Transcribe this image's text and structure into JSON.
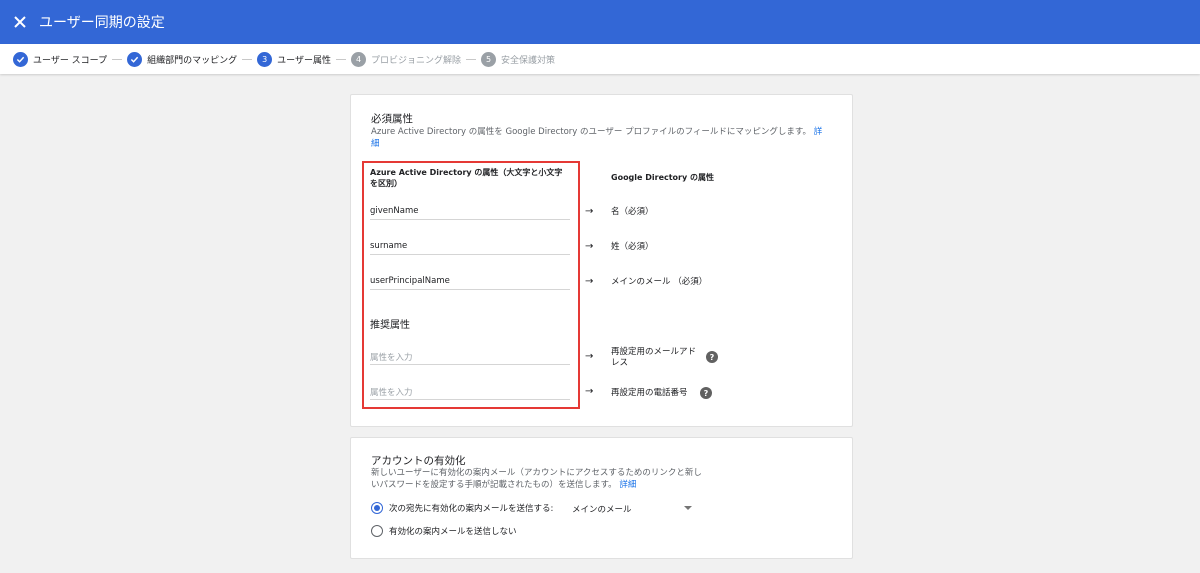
{
  "header": {
    "title": "ユーザー同期の設定"
  },
  "steps": [
    {
      "label": "ユーザー スコープ",
      "marker": "",
      "state": "done"
    },
    {
      "label": "組織部門のマッピング",
      "marker": "",
      "state": "done"
    },
    {
      "label": "ユーザー属性",
      "marker": "3",
      "state": "active"
    },
    {
      "label": "プロビジョニング解除",
      "marker": "4",
      "state": "disabled"
    },
    {
      "label": "安全保護対策",
      "marker": "5",
      "state": "disabled"
    }
  ],
  "required": {
    "title": "必須属性",
    "desc": "Azure Active Directory の属性を Google Directory のユーザー プロファイルのフィールドにマッピングします。",
    "learn_more_1": "詳",
    "learn_more_2": "細",
    "col_left": "Azure Active Directory の属性（大文字と小文字を区別）",
    "col_right": "Google Directory の属性",
    "rows": [
      {
        "source": "givenName",
        "target": "名（必須）"
      },
      {
        "source": "surname",
        "target": "姓（必須）"
      },
      {
        "source": "userPrincipalName",
        "target": "メインのメール （必須）"
      }
    ],
    "recommended_title": "推奨属性",
    "recommended": [
      {
        "placeholder": "属性を入力",
        "target": "再設定用のメールアドレス"
      },
      {
        "placeholder": "属性を入力",
        "target": "再設定用の電話番号"
      }
    ],
    "arrow": "→",
    "help": "?"
  },
  "activation": {
    "title": "アカウントの有効化",
    "desc_line1": "新しいユーザーに有効化の案内メール（アカウントにアクセスするためのリンクと新し",
    "desc_line2": "いパスワードを設定する手順が記載されたもの）を送信します。",
    "learn_more": "詳細",
    "option1": "次の宛先に有効化の案内メールを送信する:",
    "option1_value": "メインのメール",
    "option2": "有効化の案内メールを送信しない"
  },
  "colors": {
    "header": "#3367d6",
    "highlight": "#e53935",
    "link": "#1a73e8"
  },
  "icons": {
    "close": "close-icon",
    "check": "check-icon",
    "help": "help-icon"
  }
}
